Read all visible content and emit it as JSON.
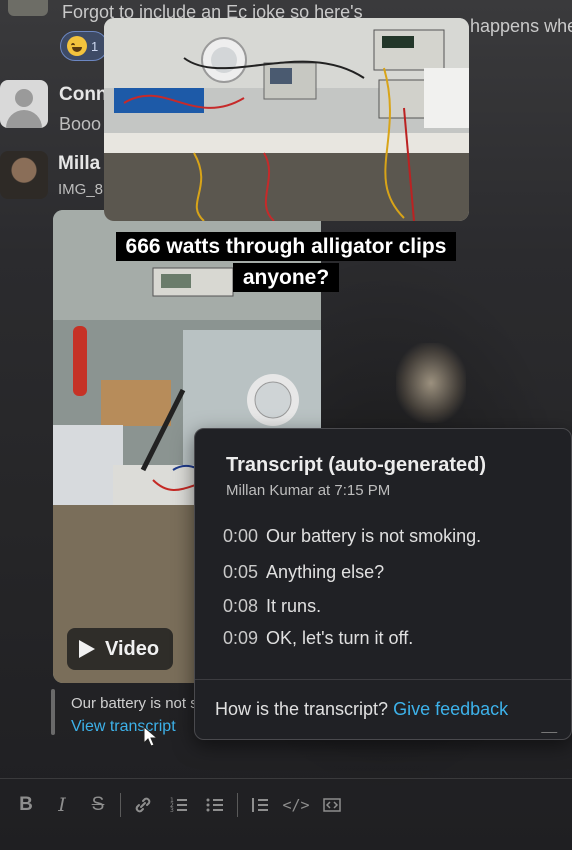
{
  "feed": {
    "top_message_text": "Forgot to include an Ec joke so here's",
    "top_message_right": "happens whe",
    "reaction": {
      "emoji": "grinning-squint-emoji",
      "count": "1"
    },
    "conversations": [
      {
        "name": "Conn",
        "preview": "Booo"
      },
      {
        "name": "Milla",
        "preview": "IMG_8"
      }
    ]
  },
  "caption": {
    "line1": "666 watts through alligator clips",
    "line2": "anyone?"
  },
  "video": {
    "button_label": "Video",
    "snippet": "Our battery is not smoking.",
    "view_transcript": "View transcript"
  },
  "transcript": {
    "title": "Transcript (auto-generated)",
    "author_time": "Millan Kumar at 7:15 PM",
    "lines": [
      {
        "time": "0:00",
        "text": "Our battery is not smoking."
      },
      {
        "time": "0:05",
        "text": "Anything else?"
      },
      {
        "time": "0:08",
        "text": "It runs."
      },
      {
        "time": "0:09",
        "text": "OK, let's turn it off."
      }
    ],
    "footer_question": "How is the transcript?",
    "footer_link": "Give feedback"
  },
  "toolbar": {
    "bold": "B",
    "italic": "I",
    "strike": "S",
    "code": "</>",
    "code_block": "</>"
  },
  "colors": {
    "link": "#3db2ea",
    "popup_bg": "#202125",
    "caption_bg": "#000000"
  }
}
